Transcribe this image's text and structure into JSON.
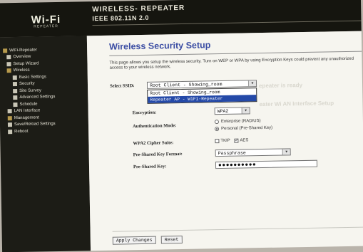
{
  "header": {
    "logo": "Wi-Fi",
    "logo_sub": "REPEATER",
    "title": "WIRELESS- REPEATER",
    "subtitle": "IEEE 802.11N 2.0"
  },
  "sidebar": {
    "root": "WiFi-Repeater",
    "items": [
      {
        "label": "Overview",
        "level": 1,
        "icon": "doc"
      },
      {
        "label": "Setup Wizard",
        "level": 1,
        "icon": "doc"
      },
      {
        "label": "Wireless",
        "level": 1,
        "icon": "folder"
      },
      {
        "label": "Basic Settings",
        "level": 2,
        "icon": "doc"
      },
      {
        "label": "Security",
        "level": 2,
        "icon": "doc"
      },
      {
        "label": "Site Survey",
        "level": 2,
        "icon": "doc"
      },
      {
        "label": "Advanced Settings",
        "level": 2,
        "icon": "doc"
      },
      {
        "label": "Schedule",
        "level": 2,
        "icon": "doc"
      },
      {
        "label": "LAN Interface",
        "level": 1,
        "icon": "doc"
      },
      {
        "label": "Management",
        "level": 1,
        "icon": "folder"
      },
      {
        "label": "Save/Reload Settings",
        "level": 1,
        "icon": "doc"
      },
      {
        "label": "Reboot",
        "level": 1,
        "icon": "doc"
      }
    ]
  },
  "main": {
    "title": "Wireless Security Setup",
    "description": "This page allows you setup the wireless security. Turn on WEP or WPA by using Encryption Keys could prevent any unauthorized access to your wireless network.",
    "select_ssid_label": "Select SSID:",
    "select_ssid_value": "Root Client - Showing_room",
    "ssid_options": [
      "Root Client - Showing_room",
      "Repeater AP - WiFi-Repeater"
    ],
    "encryption_label": "Encryption:",
    "encryption_value": "WPA2",
    "auth_label": "Authentication Mode:",
    "auth_options": [
      "Enterprise (RADIUS)",
      "Personal (Pre-Shared Key)"
    ],
    "auth_selected": 1,
    "cipher_label": "WPA2 Cipher Suite:",
    "cipher_tkip": "TKIP",
    "cipher_aes": "AES",
    "psk_format_label": "Pre-Shared Key Format:",
    "psk_format_value": "Passphrase",
    "psk_label": "Pre-Shared Key:",
    "psk_value": "●●●●●●●●●●",
    "apply_button": "Apply Changes",
    "reset_button": "Reset",
    "bg_text_1": "epeater is ready",
    "bg_text_2": "eater Wi AN Interface Setup"
  },
  "colors": {
    "header_bg": "#15150f",
    "sidebar_bg": "#1c1c16",
    "title_color": "#3b4da3",
    "dropdown_highlight": "#2449a8"
  }
}
